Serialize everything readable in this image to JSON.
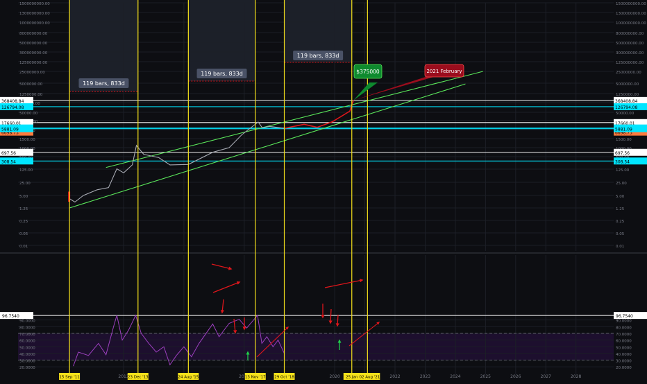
{
  "chart_data": [
    {
      "type": "line",
      "panel": "price",
      "y_scale": "log",
      "ylim": [
        0.01,
        1500000000
      ],
      "y_ticks": [
        "1500000000.00",
        "1300000000.00",
        "1000000000.00",
        "800000000.00",
        "500000000.00",
        "300000000.00",
        "125000000.00",
        "25000000.00",
        "5000000.00",
        "1250000.00",
        "250000.00",
        "50000.00",
        "25000.00",
        "5000.00",
        "1500.00",
        "1000.00",
        "500.00",
        "125.00",
        "25.00",
        "5.00",
        "1.25",
        "0.25",
        "0.05",
        "0.01"
      ],
      "x_ticks": [
        "2013",
        "2015",
        "2017",
        "2020",
        "2021",
        "2022",
        "2023",
        "2024",
        "2025",
        "2026",
        "2027",
        "2028"
      ],
      "date_badges": [
        "15 Sep '11",
        "23 Dec '13",
        "24 Aug '15",
        "13 Nov '17",
        "29 Oct '18",
        "25 Jan",
        "02 Aug '21"
      ],
      "levels_right": [
        "368408.84",
        "126794.08",
        "17660.01",
        "6693.49",
        "6698.73",
        "5881.09",
        "697.56",
        "308.54"
      ],
      "levels_left": [
        "368408.84",
        "126794.08",
        "17660.01",
        "6693.49",
        "6698.73",
        "5881.09",
        "697.56",
        "308.54"
      ],
      "level_colors": [
        "#ffffff",
        "#00e5ff",
        "#ffffff",
        "#00e5ff",
        "#ff7a3d",
        "#00e5ff",
        "#ffffff",
        "#00e5ff"
      ],
      "cycle_ranges": [
        "119 bars, 833d",
        "119 bars, 833d",
        "119 bars, 833d"
      ],
      "callouts": [
        "$375000",
        "2021 February"
      ],
      "callout_colors": [
        "#0e8a2e",
        "#9b0d1d"
      ],
      "series": [
        {
          "values": [
            {
              "x": "2011-09-15",
              "y": 3.5
            },
            {
              "x": "2011-11-20",
              "y": 2.4
            },
            {
              "x": "2012-03-01",
              "y": 5
            },
            {
              "x": "2012-08-15",
              "y": 10
            },
            {
              "x": "2013-01-01",
              "y": 13
            },
            {
              "x": "2013-04-10",
              "y": 130
            },
            {
              "x": "2013-07-01",
              "y": 80
            },
            {
              "x": "2013-10-15",
              "y": 200
            },
            {
              "x": "2013-12-04",
              "y": 1100
            },
            {
              "x": "2014-03-01",
              "y": 600
            },
            {
              "x": "2014-09-01",
              "y": 450
            },
            {
              "x": "2015-01-15",
              "y": 200
            },
            {
              "x": "2015-08-24",
              "y": 210
            },
            {
              "x": "2016-06-15",
              "y": 700
            },
            {
              "x": "2017-01-01",
              "y": 1000
            },
            {
              "x": "2017-06-01",
              "y": 2500
            },
            {
              "x": "2017-12-17",
              "y": 19500
            },
            {
              "x": "2018-02-06",
              "y": 7000
            },
            {
              "x": "2018-05-01",
              "y": 9000
            },
            {
              "x": "2018-10-29",
              "y": 6300
            },
            {
              "x": "2019-06-26",
              "y": 13000
            },
            {
              "x": "2019-12-01",
              "y": 7500
            },
            {
              "x": "2020-06-01",
              "y": 20000
            },
            {
              "x": "2021-01-01",
              "y": 60000
            },
            {
              "x": "2021-02-15",
              "y": 375000
            }
          ]
        }
      ]
    },
    {
      "type": "line",
      "panel": "oscillator",
      "ylim": [
        20,
        100
      ],
      "y_ticks": [
        "90.0000",
        "80.0000",
        "70.0000",
        "60.0000",
        "50.0000",
        "40.0000",
        "30.0000",
        "20.0000"
      ],
      "level_badge": "96.7540",
      "bands": [
        30,
        70
      ],
      "series": [
        {
          "values": [
            {
              "x": "2011-11-01",
              "y": 21
            },
            {
              "x": "2012-01-01",
              "y": 42
            },
            {
              "x": "2012-05-01",
              "y": 37
            },
            {
              "x": "2012-09-01",
              "y": 55
            },
            {
              "x": "2012-12-01",
              "y": 38
            },
            {
              "x": "2013-03-01",
              "y": 80
            },
            {
              "x": "2013-04-10",
              "y": 97
            },
            {
              "x": "2013-06-15",
              "y": 60
            },
            {
              "x": "2013-09-01",
              "y": 75
            },
            {
              "x": "2013-11-25",
              "y": 97
            },
            {
              "x": "2014-02-01",
              "y": 70
            },
            {
              "x": "2014-05-01",
              "y": 55
            },
            {
              "x": "2014-08-01",
              "y": 42
            },
            {
              "x": "2014-11-01",
              "y": 50
            },
            {
              "x": "2015-01-14",
              "y": 23
            },
            {
              "x": "2015-04-01",
              "y": 37
            },
            {
              "x": "2015-07-01",
              "y": 50
            },
            {
              "x": "2015-10-01",
              "y": 35
            },
            {
              "x": "2016-01-01",
              "y": 55
            },
            {
              "x": "2016-06-15",
              "y": 84
            },
            {
              "x": "2016-09-01",
              "y": 65
            },
            {
              "x": "2017-01-01",
              "y": 85
            },
            {
              "x": "2017-05-01",
              "y": 91
            },
            {
              "x": "2017-08-01",
              "y": 78
            },
            {
              "x": "2017-12-10",
              "y": 97
            },
            {
              "x": "2018-02-01",
              "y": 55
            },
            {
              "x": "2018-04-01",
              "y": 65
            },
            {
              "x": "2018-06-15",
              "y": 50
            },
            {
              "x": "2018-08-15",
              "y": 60
            },
            {
              "x": "2018-10-29",
              "y": 40
            }
          ]
        }
      ]
    }
  ]
}
